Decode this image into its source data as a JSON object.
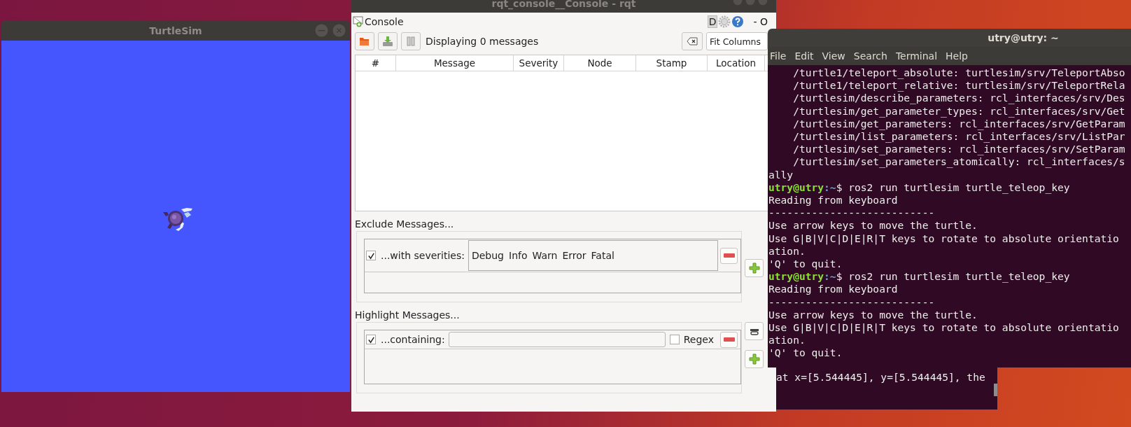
{
  "turtlesim_window": {
    "title": "TurtleSim"
  },
  "console_window": {
    "title": "rqt_console__Console - rqt",
    "plugin_title": "Console",
    "corner_button": "D",
    "corner_text": "- O",
    "toolbar": {
      "status": "Displaying 0 messages",
      "fit_button": "Fit Columns"
    },
    "table": {
      "columns": [
        "#",
        "Message",
        "Severity",
        "Node",
        "Stamp",
        "Location"
      ]
    },
    "exclude": {
      "title": "Exclude Messages...",
      "filters": [
        {
          "kind": "severities",
          "checked": true,
          "label": "...with severities:",
          "severities": [
            "Debug",
            "Info",
            "Warn",
            "Error",
            "Fatal"
          ]
        }
      ]
    },
    "highlight": {
      "title": "Highlight Messages...",
      "filters": [
        {
          "kind": "text",
          "checked": true,
          "label": "...containing:",
          "regex": {
            "label": "Regex",
            "checked": false
          }
        }
      ]
    }
  },
  "terminal": {
    "title": "utry@utry: ~",
    "menu": [
      "File",
      "Edit",
      "View",
      "Search",
      "Terminal",
      "Help"
    ],
    "lines": [
      {
        "kind": "output",
        "text": "    /turtle1/teleport_absolute: turtlesim/srv/TeleportAbso"
      },
      {
        "kind": "output",
        "text": "    /turtle1/teleport_relative: turtlesim/srv/TeleportRela"
      },
      {
        "kind": "output",
        "text": "    /turtlesim/describe_parameters: rcl_interfaces/srv/Des"
      },
      {
        "kind": "output",
        "text": "    /turtlesim/get_parameter_types: rcl_interfaces/srv/Get"
      },
      {
        "kind": "output",
        "text": "    /turtlesim/get_parameters: rcl_interfaces/srv/GetParam"
      },
      {
        "kind": "output",
        "text": "    /turtlesim/list_parameters: rcl_interfaces/srv/ListPar"
      },
      {
        "kind": "output",
        "text": "    /turtlesim/set_parameters: rcl_interfaces/srv/SetParam"
      },
      {
        "kind": "output",
        "text": "    /turtlesim/set_parameters_atomically: rcl_interfaces/s"
      },
      {
        "kind": "output",
        "text": "ally"
      },
      {
        "kind": "prompt",
        "user": "utry@utry",
        "path": ":~",
        "symbol": "$",
        "command": " ros2 run turtlesim turtle_teleop_key"
      },
      {
        "kind": "output",
        "text": "Reading from keyboard"
      },
      {
        "kind": "output",
        "text": "---------------------------"
      },
      {
        "kind": "output",
        "text": "Use arrow keys to move the turtle."
      },
      {
        "kind": "output",
        "text": "Use G|B|V|C|D|E|R|T keys to rotate to absolute orientatio"
      },
      {
        "kind": "output",
        "text": "ation."
      },
      {
        "kind": "output",
        "text": "'Q' to quit."
      },
      {
        "kind": "prompt",
        "user": "utry@utry",
        "path": ":~",
        "symbol": "$",
        "command": " ros2 run turtlesim turtle_teleop_key"
      },
      {
        "kind": "output",
        "text": "Reading from keyboard"
      },
      {
        "kind": "output",
        "text": "---------------------------"
      },
      {
        "kind": "output",
        "text": "Use arrow keys to move the turtle."
      },
      {
        "kind": "output",
        "text": "Use G|B|V|C|D|E|R|T keys to rotate to absolute orientatio"
      },
      {
        "kind": "output",
        "text": "ation."
      },
      {
        "kind": "output",
        "text": "'Q' to quit."
      }
    ]
  },
  "background_terminal": {
    "lines": [
      "at x=[5.544445], y=[5.544445], the"
    ]
  }
}
